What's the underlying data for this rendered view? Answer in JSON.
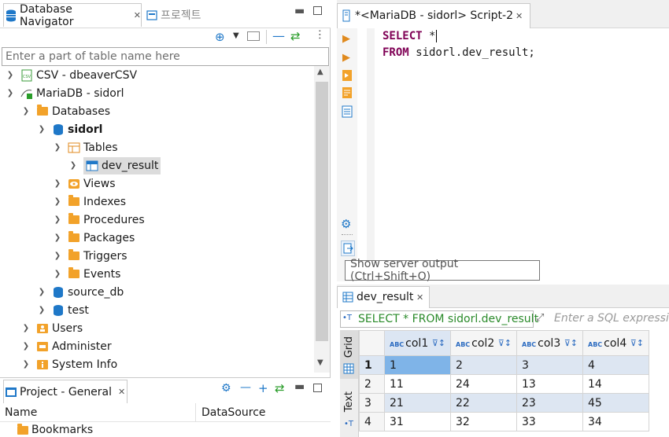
{
  "navigator": {
    "tab_title": "Database Navigator",
    "tab2_title": "프로젝트",
    "filter_placeholder": "Enter a part of table name here",
    "tree": [
      {
        "label": "CSV - dbeaverCSV"
      },
      {
        "label": "MariaDB - sidorl"
      },
      {
        "label": "Databases"
      },
      {
        "label": "sidorl"
      },
      {
        "label": "Tables"
      },
      {
        "label": "dev_result"
      },
      {
        "label": "Views"
      },
      {
        "label": "Indexes"
      },
      {
        "label": "Procedures"
      },
      {
        "label": "Packages"
      },
      {
        "label": "Triggers"
      },
      {
        "label": "Events"
      },
      {
        "label": "source_db"
      },
      {
        "label": "test"
      },
      {
        "label": "Users"
      },
      {
        "label": "Administer"
      },
      {
        "label": "System Info"
      }
    ]
  },
  "project": {
    "tab_title": "Project - General",
    "columns": [
      "Name",
      "DataSource"
    ],
    "rows": [
      {
        "name": "Bookmarks"
      }
    ]
  },
  "editor": {
    "tab_title": "*<MariaDB - sidorl> Script-2",
    "line1_kw": "SELECT",
    "line1_rest": " *",
    "line2_kw": "FROM",
    "line2_rest": " sidorl.dev_result;",
    "tooltip": "Show server output (Ctrl+Shift+O)"
  },
  "results": {
    "tab_title": "dev_result",
    "query_text": "SELECT * FROM sidorl.dev_result",
    "filter_placeholder": "Enter a SQL expression",
    "side_grid_label": "Grid",
    "side_text_label": "Text",
    "columns": [
      "col1",
      "col2",
      "col3",
      "col4"
    ],
    "rows": [
      {
        "num": "1",
        "cells": [
          "1",
          "2",
          "3",
          "4"
        ]
      },
      {
        "num": "2",
        "cells": [
          "11",
          "24",
          "13",
          "14"
        ]
      },
      {
        "num": "3",
        "cells": [
          "21",
          "22",
          "23",
          "45"
        ]
      },
      {
        "num": "4",
        "cells": [
          "31",
          "32",
          "33",
          "34"
        ]
      }
    ]
  },
  "colors": {
    "accent": "#1f78c8",
    "folder": "#f2a22a",
    "keyword": "#7f0055",
    "selected_cell": "#7fb4e8",
    "row_stripe": "#dde6f2"
  }
}
